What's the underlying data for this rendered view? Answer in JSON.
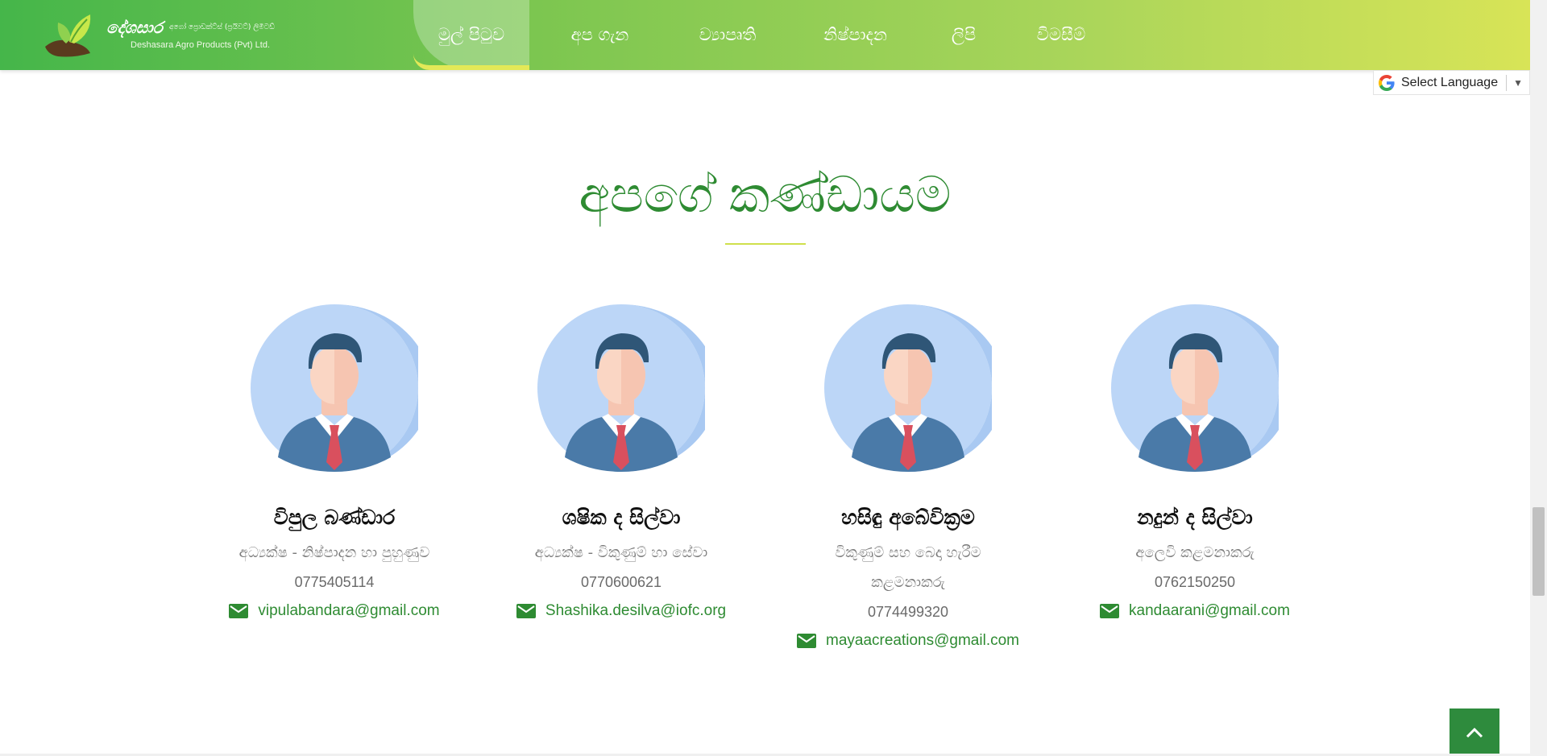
{
  "header": {
    "logo_name": "දේශසාර",
    "logo_sub_si": "අගෝ ප්‍රොඩක්ට්ස් (ප්‍රයිවට්) ලිමිටඩ්",
    "logo_sub_en": "Deshasara Agro Products (Pvt) Ltd.",
    "nav": [
      {
        "label": "මුල් පිටුව",
        "active": true
      },
      {
        "label": "අප ගැන"
      },
      {
        "label": "ව්‍යාපෘති"
      },
      {
        "label": "නිෂ්පාදන"
      },
      {
        "label": "ලිපි"
      },
      {
        "label": "විමසීම්"
      }
    ]
  },
  "translate": {
    "label": "Select Language",
    "caret": "▼"
  },
  "team_section": {
    "title": "අපගේ කණ්ඩායම",
    "members": [
      {
        "name": "විපුල බණ්ඩාර",
        "role": "අධ්‍යක්ෂ - නිෂ්පාදන හා පුහුණුව",
        "phone": "0775405114",
        "email": "vipulabandara@gmail.com"
      },
      {
        "name": "ශෂික ද සිල්වා",
        "role": "අධ්‍යක්ෂ - විකුණුම් හා සේවා",
        "phone": "0770600621",
        "email": "Shashika.desilva@iofc.org"
      },
      {
        "name": "හසිඳු අබේවික්‍රම",
        "role": "විකුණුම් සහ බෙදා හැරීම කළමනාකරු",
        "phone": "0774499320",
        "email": "mayaacreations@gmail.com"
      },
      {
        "name": "නදුන් ද සිල්වා",
        "role": "අලෙවි කළමනාකරු",
        "phone": "0762150250",
        "email": "kandaarani@gmail.com"
      }
    ]
  },
  "colors": {
    "brand_green": "#2e8b32",
    "accent_yellow": "#d8e457"
  },
  "icons": {
    "mail": "envelope-icon",
    "back_to_top": "chevron-up-icon",
    "avatar": "person-avatar-icon"
  }
}
